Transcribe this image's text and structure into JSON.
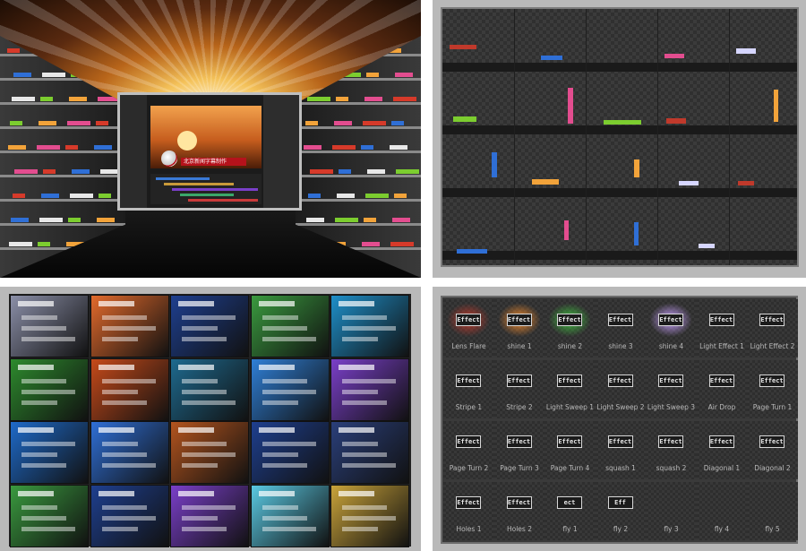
{
  "panel_a": {
    "monitor_caption": "北京新闻字幕制作",
    "colors": {
      "rays_center": "#fff6d8",
      "rays_mid": "#f4c25a",
      "rays_edge": "#5a2a10"
    }
  },
  "panel_b": {
    "rows": 4,
    "cols": 5,
    "colors": [
      "#c0392b",
      "#2f6fd6",
      "#7ccd2f",
      "#e34d8f",
      "#f2a33a",
      "#d6d6ff"
    ]
  },
  "panel_c": {
    "tile_colors": [
      [
        "#8b8fa8",
        "#e26a2c",
        "#1e3f8f",
        "#3a9a3f",
        "#1e8fc9"
      ],
      [
        "#2d8a2d",
        "#c64a1a",
        "#1e6a8f",
        "#2f7fd6",
        "#7a3fc9"
      ],
      [
        "#1e6ac9",
        "#2f6fd6",
        "#b3541e",
        "#1e3f8f",
        "#2a3f7a"
      ],
      [
        "#3a9a3f",
        "#1e3f8f",
        "#7a3fc9",
        "#5ac9e3",
        "#c9a33a"
      ]
    ]
  },
  "panel_d": {
    "effects": [
      {
        "label": "Lens Flare",
        "badge": "Effect",
        "glow": "#c0392b"
      },
      {
        "label": "shine 1",
        "badge": "Effect",
        "glow": "#f28a2c"
      },
      {
        "label": "shine 2",
        "badge": "Effect",
        "glow": "#3fbf3f"
      },
      {
        "label": "shine 3",
        "badge": "Effect",
        "glow": ""
      },
      {
        "label": "shine 4",
        "badge": "Effect",
        "glow": "#c9a0ff"
      },
      {
        "label": "Light Effect 1",
        "badge": "Effect",
        "glow": ""
      },
      {
        "label": "Light Effect 2",
        "badge": "Effect",
        "glow": ""
      },
      {
        "label": "Stripe 1",
        "badge": "Effect",
        "glow": ""
      },
      {
        "label": "Stripe 2",
        "badge": "Effect",
        "glow": ""
      },
      {
        "label": "Light Sweep 1",
        "badge": "Effect",
        "glow": ""
      },
      {
        "label": "Light Sweep 2",
        "badge": "Effect",
        "glow": ""
      },
      {
        "label": "Light Sweep 3",
        "badge": "Effect",
        "glow": ""
      },
      {
        "label": "Air Drop",
        "badge": "Effect",
        "glow": ""
      },
      {
        "label": "Page Turn 1",
        "badge": "Effect",
        "glow": ""
      },
      {
        "label": "Page Turn 2",
        "badge": "Effect",
        "glow": ""
      },
      {
        "label": "Page Turn 3",
        "badge": "Effect",
        "glow": ""
      },
      {
        "label": "Page Turn 4",
        "badge": "Effect",
        "glow": ""
      },
      {
        "label": "squash 1",
        "badge": "Effect",
        "glow": ""
      },
      {
        "label": "squash 2",
        "badge": "Effect",
        "glow": ""
      },
      {
        "label": "Diagonal 1",
        "badge": "Effect",
        "glow": ""
      },
      {
        "label": "Diagonal 2",
        "badge": "Effect",
        "glow": ""
      },
      {
        "label": "Holes 1",
        "badge": "Effect",
        "glow": ""
      },
      {
        "label": "Holes 2",
        "badge": "Effect",
        "glow": ""
      },
      {
        "label": "fly 1",
        "badge": "ect",
        "glow": ""
      },
      {
        "label": "fly 2",
        "badge": "Eff",
        "glow": ""
      },
      {
        "label": "fly 3",
        "badge": "",
        "glow": ""
      },
      {
        "label": "fly 4",
        "badge": "",
        "glow": ""
      },
      {
        "label": "fly 5",
        "badge": "",
        "glow": ""
      }
    ]
  }
}
